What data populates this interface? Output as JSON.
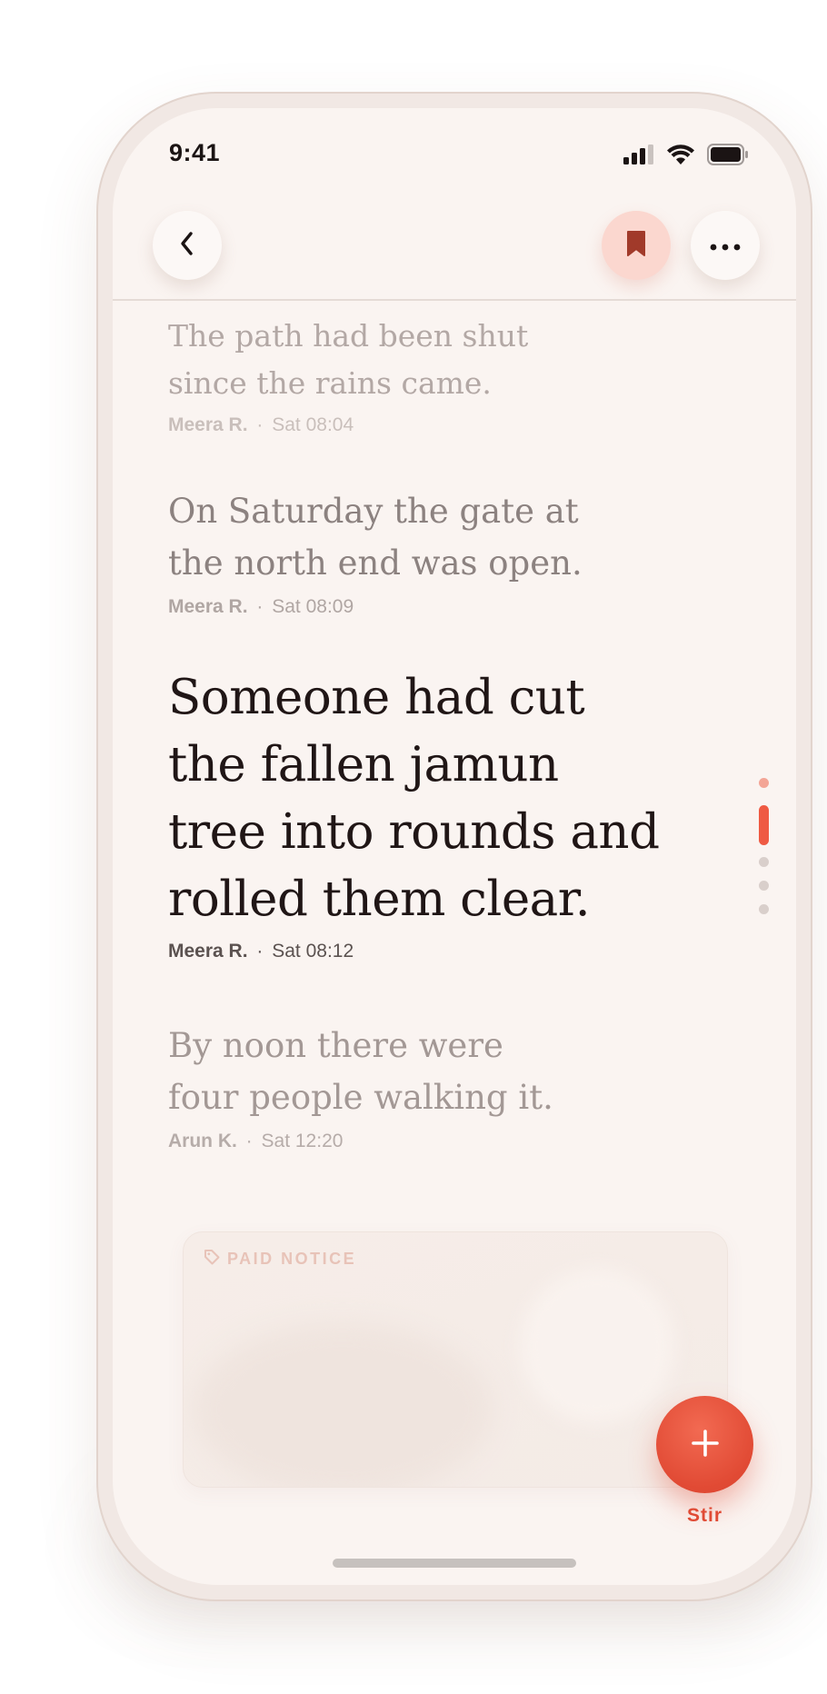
{
  "status_bar": {
    "time": "9:41"
  },
  "top_bar": {
    "back_icon": "chevron-left-icon",
    "bookmark_icon": "bookmark-icon",
    "more_icon": "more-horizontal-icon"
  },
  "messages": [
    {
      "lines": [
        "The path had been shut",
        "since the rains came."
      ],
      "author": "Meera R.",
      "separator": "·",
      "time": "Sat 08:04"
    },
    {
      "lines": [
        "On Saturday the gate at",
        "the north end was open."
      ],
      "author": "Meera R.",
      "separator": "·",
      "time": "Sat 08:09"
    },
    {
      "lines": [
        "Someone had cut",
        "the fallen jamun",
        "tree into rounds and",
        "rolled them clear."
      ],
      "author": "Meera R.",
      "separator": "·",
      "time": "Sat 08:12"
    },
    {
      "lines": [
        "By noon there were",
        "four people walking it."
      ],
      "author": "Arun K.",
      "separator": "·",
      "time": "Sat 12:20"
    }
  ],
  "notice": {
    "label": "PAID NOTICE",
    "icon": "tag-icon"
  },
  "fab": {
    "label": "Stir",
    "icon": "plus-icon"
  },
  "colors": {
    "accent": "#E14A34",
    "accent_soft": "#FBD7CF",
    "background": "#FAF4F1",
    "text_primary": "#201616"
  }
}
